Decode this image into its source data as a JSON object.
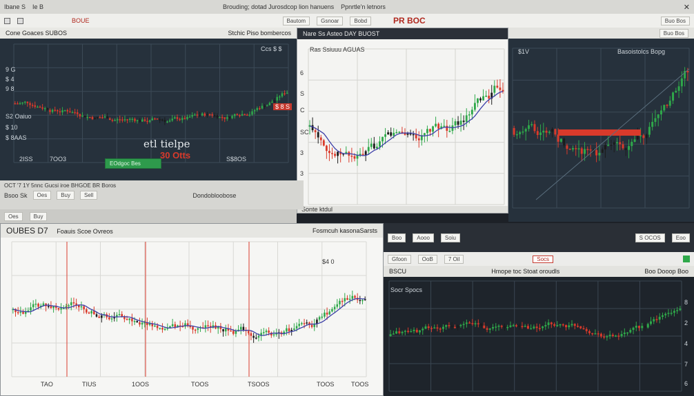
{
  "top_bar": {
    "left_text": "Ibane S",
    "mid_text": "Ie B",
    "center_text": "Brouding; dotad Jurosdcop lion hanuens",
    "right_text": "Ppnrtle'n letnors",
    "logo_text": "PR BOC"
  },
  "toolbar": {
    "left_icon_label": "",
    "doc_label": "BOUE",
    "center_chips": [
      "Bautom",
      "Gsnoar",
      "Bobd"
    ],
    "right_text": "Buo Bos"
  },
  "panel_tl": {
    "title": "Cone Goaces SUBOS",
    "subtitle": "Stchic Piso bombercos",
    "y_labels": [
      "9 G",
      "$ 4",
      "9 8",
      "S2 Oaiuo",
      "$ 10",
      "$ 8AAS"
    ],
    "x_labels": [
      "2ISS",
      "7OO3",
      "S$8OS"
    ],
    "top_right": "Ccs $ $",
    "price_flag": "$ 8 S",
    "watermark": "etl tielpe",
    "badge": "30 Otts",
    "button": "EOdgoc Bes"
  },
  "panel_tr": {
    "title": "Nare Ss Asteo DAY BUOST",
    "subtitle": "Ras Ssiuuu AGUAS",
    "y_labels": [
      "6",
      "S",
      "C",
      "SC",
      "3",
      "3"
    ],
    "right_title": "Basoistolcs Bopg",
    "right_value": "$1V",
    "footer": "Sonte ktdul"
  },
  "mid_strip": {
    "left": "Bsoo Sk",
    "chips": [
      "Oes",
      "Buy",
      "Sell"
    ],
    "right": "Dondobloobose",
    "text": "OCT '7 1Y 5nnc Gucsi iroe BHGOE BR Boros"
  },
  "panel_bl": {
    "title": "OUBES D7",
    "subtitle": "Foauis Scoe Ovreos",
    "top_right": "Fosmcuh kasonaSarsts",
    "price": "$4 0",
    "x_labels": [
      "TAO",
      "TIUS",
      "1OOS",
      "TOOS",
      "TSOOS",
      "TOOS",
      "TOOS"
    ]
  },
  "panel_br": {
    "header_left": "Gfoon",
    "header_chips": [
      "Boo",
      "Aooo",
      "Soiu"
    ],
    "red_tag": "Socs",
    "title_line": "Hmope toc Stoat oroudls",
    "label_left": "BSCU",
    "label_right": "Boo Dooop Boo",
    "sub_left": "Socr Spocs",
    "sub_mid": "OoB",
    "sub_right": "7 Oil",
    "y_labels": [
      "8",
      "2",
      "4",
      "7",
      "6"
    ],
    "buttons": [
      "S OCOS",
      "Eoo"
    ]
  },
  "colors": {
    "bg_dark": "#1d2127",
    "panel_dark": "#26313c",
    "panel_light": "#f4f4f2",
    "candle_up": "#2fa84a",
    "candle_down": "#d93a2b",
    "candle_dark": "#1b1b1b",
    "trend_blue": "#3d3fa8"
  }
}
